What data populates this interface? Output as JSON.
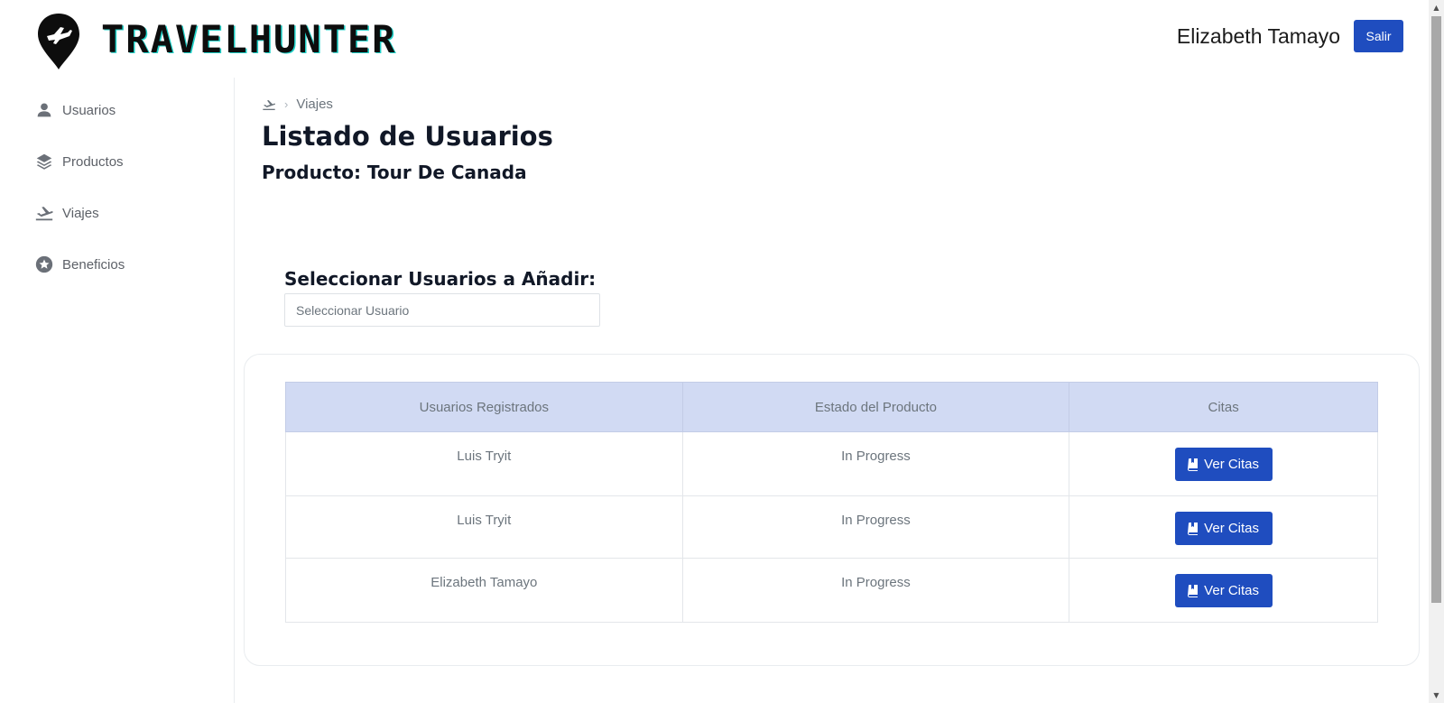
{
  "header": {
    "logo_text": "TRAVELHUNTER",
    "user_name": "Elizabeth Tamayo",
    "logout_label": "Salir"
  },
  "sidebar": {
    "items": [
      {
        "label": "Usuarios",
        "icon": "user-icon"
      },
      {
        "label": "Productos",
        "icon": "layers-icon"
      },
      {
        "label": "Viajes",
        "icon": "plane-departure-icon"
      },
      {
        "label": "Beneficios",
        "icon": "star-circle-icon"
      }
    ]
  },
  "breadcrumb": {
    "icon": "plane-departure-icon",
    "current": "Viajes"
  },
  "main": {
    "title": "Listado de Usuarios",
    "subtitle": "Producto: Tour De Canada",
    "select_label": "Seleccionar Usuarios a Añadir:",
    "select_placeholder": "Seleccionar Usuario"
  },
  "table": {
    "headers": [
      "Usuarios Registrados",
      "Estado del Producto",
      "Citas"
    ],
    "rows": [
      {
        "user": "Luis Tryit",
        "status": "In Progress",
        "action": "Ver Citas"
      },
      {
        "user": "Luis Tryit",
        "status": "In Progress",
        "action": "Ver Citas"
      },
      {
        "user": "Elizabeth Tamayo",
        "status": "In Progress",
        "action": "Ver Citas"
      }
    ]
  },
  "colors": {
    "primary": "#1f4dbf",
    "table_header": "#d1daf3",
    "accent_cyan": "#1fd1c8"
  }
}
